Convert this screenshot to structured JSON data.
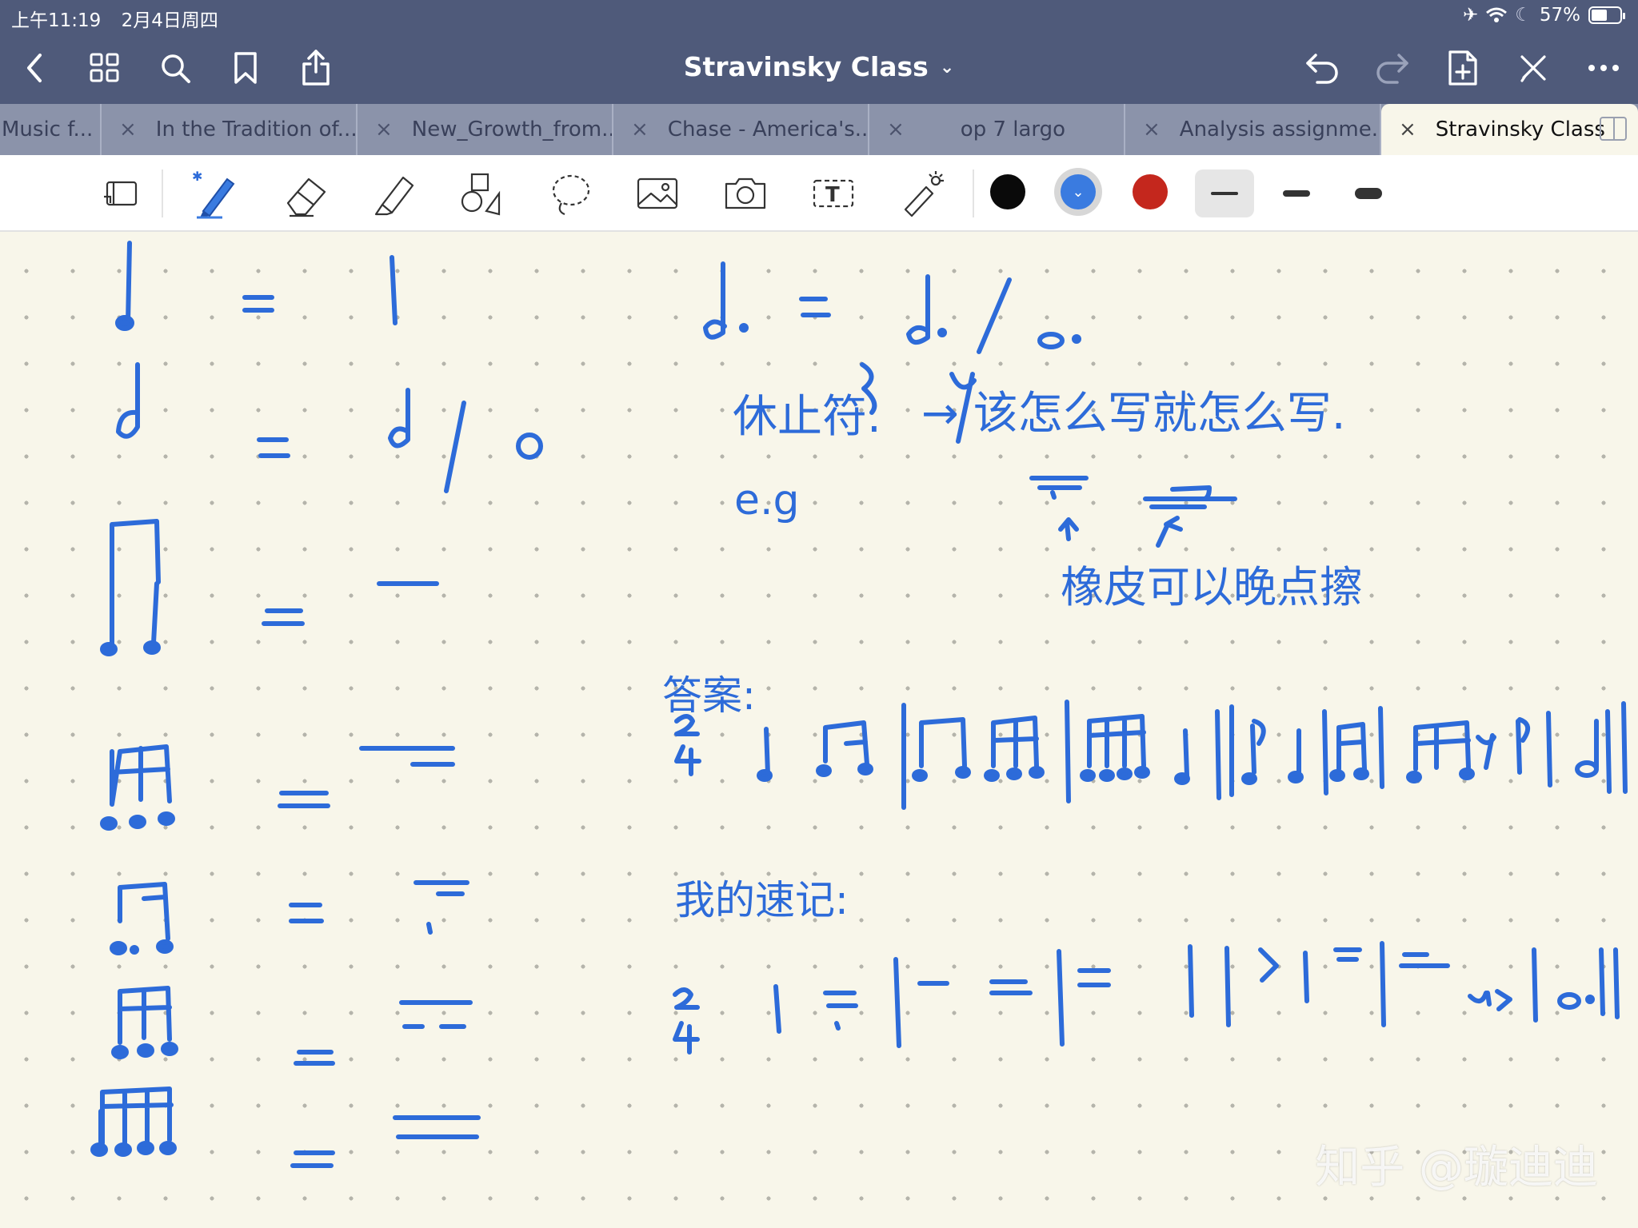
{
  "status": {
    "time": "上午11:19",
    "date": "2月4日周四",
    "battery": "57%",
    "battery_level": 0.57
  },
  "nav": {
    "title": "Stravinsky Class"
  },
  "tabs": [
    {
      "label": "Music f..."
    },
    {
      "label": "In the Tradition of..."
    },
    {
      "label": "New_Growth_from..."
    },
    {
      "label": "Chase - America's..."
    },
    {
      "label": "op 7 largo"
    },
    {
      "label": "Analysis assignme..."
    },
    {
      "label": "Stravinsky Class",
      "active": true
    }
  ],
  "toolbar": {
    "tools": [
      "read-mode",
      "pen",
      "eraser",
      "highlighter",
      "shapes",
      "lasso",
      "image",
      "camera",
      "text",
      "laser-pointer"
    ],
    "colors": [
      "#0a0a0a",
      "#3a7be0",
      "#c4271d"
    ],
    "selected_color": "#3a7be0",
    "stroke_widths": [
      "thin",
      "medium",
      "thick"
    ],
    "selected_stroke": "thin"
  },
  "notes": {
    "rest_title": "休止符.",
    "rest_rule": "→ 该怎么写就怎么写.",
    "eg": "e.g",
    "eraser_note": "橡皮可以晚点擦",
    "answer_label": "答案:",
    "my_notes_label": "我的速记:",
    "time_sig_top": "2",
    "time_sig_bottom": "4"
  },
  "watermark": "知乎 @璇迪迪"
}
